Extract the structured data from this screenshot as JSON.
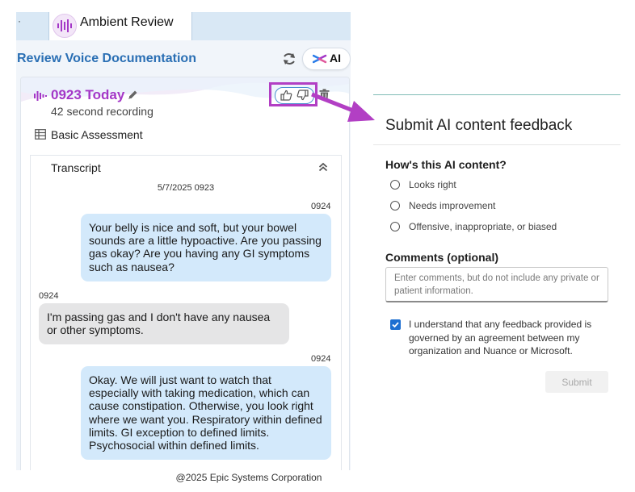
{
  "left_panel": {
    "tab_label": "Ambient Review",
    "section_title": "Review Voice Documentation",
    "ai_button_label": "AI",
    "note": {
      "title": "0923 Today",
      "subtitle": "42 second recording",
      "assessment": "Basic Assessment"
    },
    "transcript": {
      "title": "Transcript",
      "date": "5/7/2025 0923",
      "messages": [
        {
          "time": "0924",
          "side": "out",
          "text": "Your belly is nice and soft, but your bowel sounds are a little hypoactive. Are you passing gas okay? Are you having any GI symptoms such as nausea?"
        },
        {
          "time": "0924",
          "side": "in",
          "text": "I'm passing gas and I don't have any nausea or other symptoms."
        },
        {
          "time": "0924",
          "side": "out",
          "text": "Okay. We will just want to watch that especially with taking medication, which can cause constipation. Otherwise, you look right where we want you. Respiratory within defined limits. GI exception to defined limits. Psychosocial within defined limits."
        }
      ]
    }
  },
  "feedback_panel": {
    "title": "Submit AI content feedback",
    "question": "How's this AI content?",
    "options": [
      "Looks right",
      "Needs improvement",
      "Offensive, inappropriate, or biased"
    ],
    "comments_label": "Comments (optional)",
    "comments_placeholder": "Enter comments, but do not include any private or patient information.",
    "consent_checked": true,
    "consent_text": "I understand that any feedback provided is governed by an agreement between my organization and Nuance or Microsoft.",
    "submit_label": "Submit"
  },
  "footer": {
    "copyright": "@2025 Epic Systems Corporation"
  },
  "colors": {
    "brand_purple": "#a437c7",
    "highlight_box": "#b23fc4",
    "title_blue": "#2a6fb4",
    "bubble_out": "#d3e9fb",
    "bubble_in": "#e5e5e6",
    "checkbox_blue": "#1d6fd1"
  },
  "icons": [
    "ambient-logo-icon",
    "refresh-icon",
    "ai-sparkle-icon",
    "microphone-waveform-icon",
    "pencil-icon",
    "thumbs-up-icon",
    "thumbs-down-icon",
    "trash-icon",
    "grid-icon",
    "chevron-up-icon",
    "checkmark-icon",
    "arrow-icon"
  ]
}
